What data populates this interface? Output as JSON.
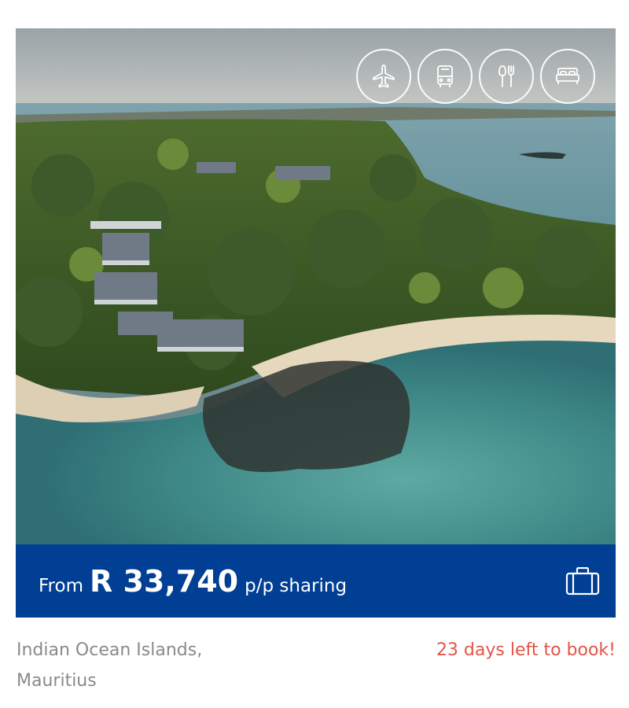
{
  "card": {
    "photo_alt": "",
    "feature_icons": [
      "airplane-icon",
      "bus-icon",
      "dining-icon",
      "bed-icon"
    ],
    "price_bar": {
      "from_label": "From",
      "amount": "R 33,740",
      "suffix": "p/p sharing",
      "icon": "suitcase-icon",
      "background_color": "#003f94"
    },
    "location_line1": "Indian Ocean Islands,",
    "location_line2": "Mauritius",
    "deadline": "23 days left to book!",
    "deadline_color": "#e2554a"
  }
}
